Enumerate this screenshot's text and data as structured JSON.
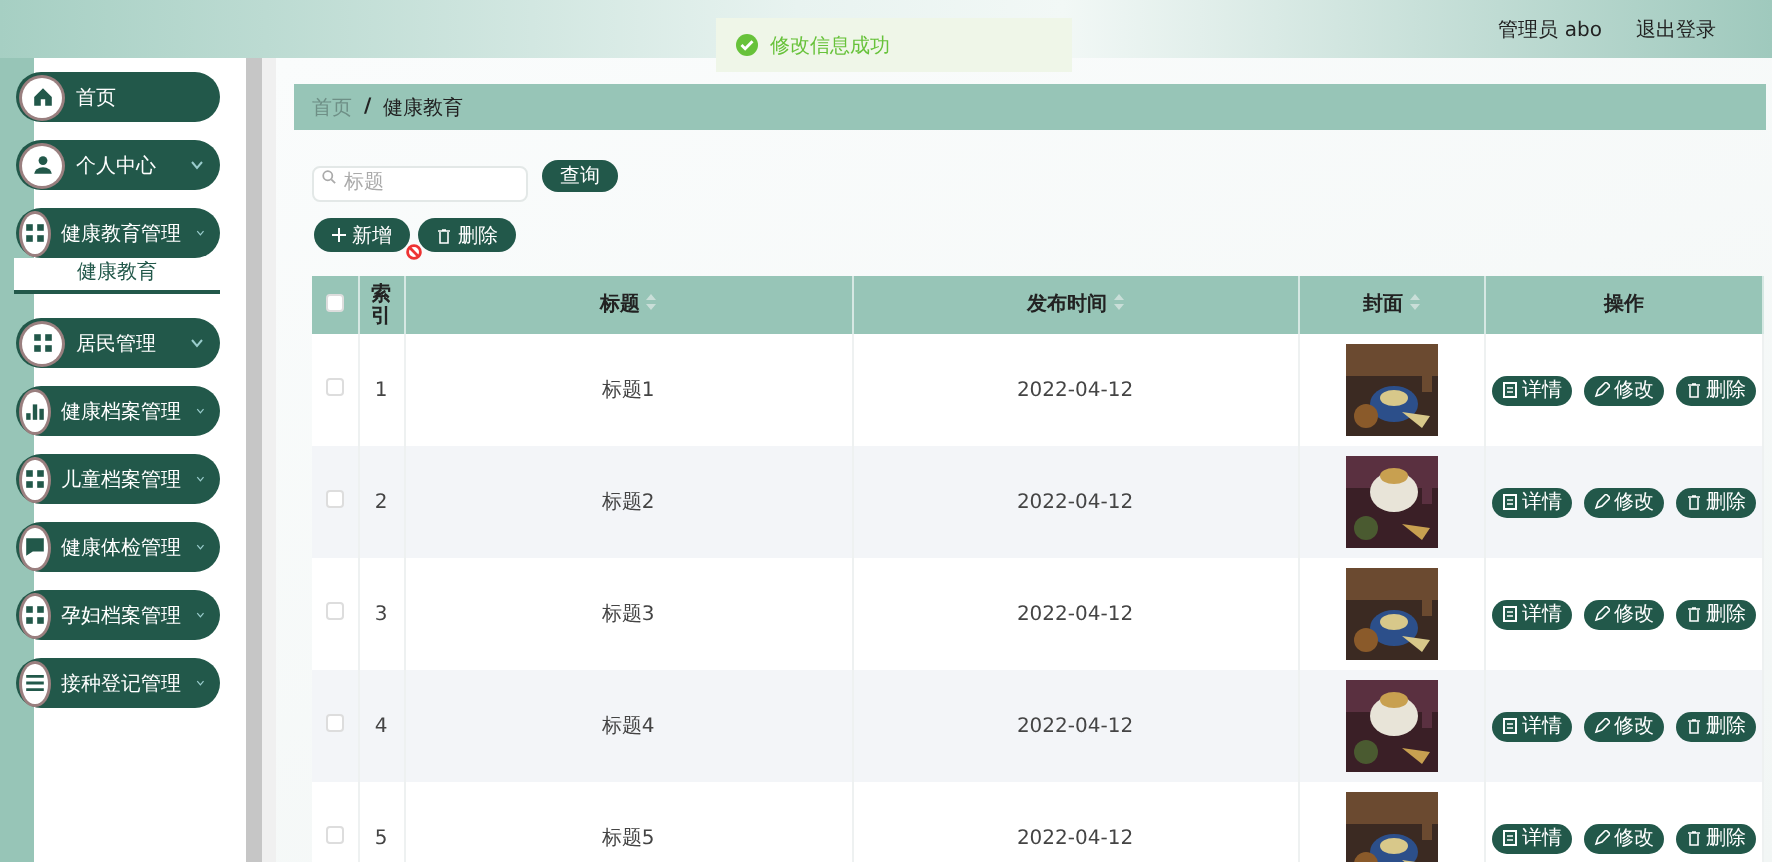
{
  "header": {
    "user": "管理员 abo",
    "logout": "退出登录"
  },
  "toast": {
    "message": "修改信息成功"
  },
  "sidebar": {
    "items": [
      {
        "label": "首页",
        "kind": "link"
      },
      {
        "label": "个人中心",
        "kind": "menu"
      },
      {
        "label": "健康教育管理",
        "kind": "menu",
        "children": [
          {
            "label": "健康教育",
            "selected": true
          }
        ]
      },
      {
        "label": "居民管理",
        "kind": "menu"
      },
      {
        "label": "健康档案管理",
        "kind": "menu"
      },
      {
        "label": "儿童档案管理",
        "kind": "menu"
      },
      {
        "label": "健康体检管理",
        "kind": "menu"
      },
      {
        "label": "孕妇档案管理",
        "kind": "menu"
      },
      {
        "label": "接种登记管理",
        "kind": "menu"
      }
    ]
  },
  "breadcrumb": [
    "首页",
    "/",
    "健康教育"
  ],
  "search": {
    "placeholder": "标题",
    "button": "查询"
  },
  "actions": [
    {
      "label": "新增",
      "kind": "add"
    },
    {
      "label": "删除",
      "kind": "delete"
    }
  ],
  "table": {
    "all_checked": false,
    "columns": [
      {
        "label": "索引",
        "sortable": false
      },
      {
        "label": "标题",
        "sortable": true
      },
      {
        "label": "发布时间",
        "sortable": true
      },
      {
        "label": "封面",
        "sortable": true
      },
      {
        "label": "操作",
        "sortable": false
      }
    ],
    "rows": [
      {
        "checked": false,
        "index": "1",
        "title": "标题1",
        "date": "2022-04-12",
        "buttons": [
          "详情",
          "修改",
          "删除"
        ]
      },
      {
        "checked": false,
        "index": "2",
        "title": "标题2",
        "date": "2022-04-12",
        "buttons": [
          "详情",
          "修改",
          "删除"
        ]
      },
      {
        "checked": false,
        "index": "3",
        "title": "标题3",
        "date": "2022-04-12",
        "buttons": [
          "详情",
          "修改",
          "删除"
        ]
      },
      {
        "checked": false,
        "index": "4",
        "title": "标题4",
        "date": "2022-04-12",
        "buttons": [
          "详情",
          "修改",
          "删除"
        ]
      },
      {
        "checked": false,
        "index": "5",
        "title": "标题5",
        "date": "2022-04-12",
        "buttons": [
          "详情",
          "修改",
          "删除"
        ]
      }
    ]
  }
}
